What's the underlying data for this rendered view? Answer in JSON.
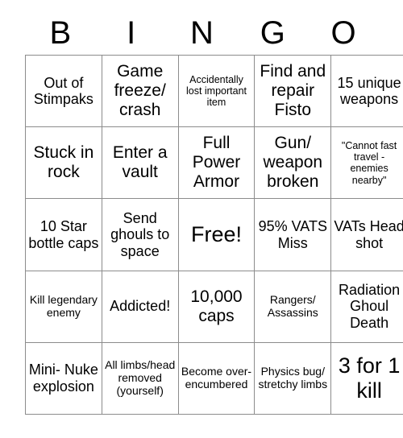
{
  "card": {
    "title": "BINGO",
    "header_letters": [
      "B",
      "I",
      "N",
      "G",
      "O"
    ],
    "grid_size": 5,
    "free_space": {
      "row": 2,
      "col": 2,
      "label": "Free!"
    },
    "colors": {
      "background": "#ffffff",
      "text": "#000000",
      "border": "#8c8c8c"
    },
    "rows": [
      [
        {
          "text": "Out of Stimpaks",
          "size": "md",
          "marked": false
        },
        {
          "text": "Game freeze/ crash",
          "size": "lg",
          "marked": false
        },
        {
          "text": "Accidentally lost important item",
          "size": "xs",
          "marked": false
        },
        {
          "text": "Find and repair Fisto",
          "size": "lg",
          "marked": false
        },
        {
          "text": "15 unique weapons",
          "size": "md",
          "marked": false
        }
      ],
      [
        {
          "text": "Stuck in rock",
          "size": "lg",
          "marked": false
        },
        {
          "text": "Enter a vault",
          "size": "lg",
          "marked": false
        },
        {
          "text": "Full Power Armor",
          "size": "lg",
          "marked": false
        },
        {
          "text": "Gun/ weapon broken",
          "size": "lg",
          "marked": false
        },
        {
          "text": "\"Cannot fast travel - enemies nearby\"",
          "size": "xs",
          "marked": false
        }
      ],
      [
        {
          "text": "10 Star bottle caps",
          "size": "md",
          "marked": false
        },
        {
          "text": "Send ghouls to space",
          "size": "md",
          "marked": false
        },
        {
          "text": "Free!",
          "size": "xl",
          "marked": false
        },
        {
          "text": "95% VATS Miss",
          "size": "md",
          "marked": false
        },
        {
          "text": "VATs Head shot",
          "size": "md",
          "marked": false
        }
      ],
      [
        {
          "text": "Kill legendary enemy",
          "size": "sm",
          "marked": false
        },
        {
          "text": "Addicted!",
          "size": "md",
          "marked": false
        },
        {
          "text": "10,000 caps",
          "size": "lg",
          "marked": false
        },
        {
          "text": "Rangers/ Assassins",
          "size": "sm",
          "marked": false
        },
        {
          "text": "Radiation Ghoul Death",
          "size": "md",
          "marked": false
        }
      ],
      [
        {
          "text": "Mini- Nuke explosion",
          "size": "md",
          "marked": false
        },
        {
          "text": "All limbs/head removed (yourself)",
          "size": "sm",
          "marked": false
        },
        {
          "text": "Become over- encumbered",
          "size": "sm",
          "marked": false
        },
        {
          "text": "Physics bug/ stretchy limbs",
          "size": "sm",
          "marked": false
        },
        {
          "text": "3 for 1 kill",
          "size": "xl",
          "marked": false
        }
      ]
    ]
  }
}
